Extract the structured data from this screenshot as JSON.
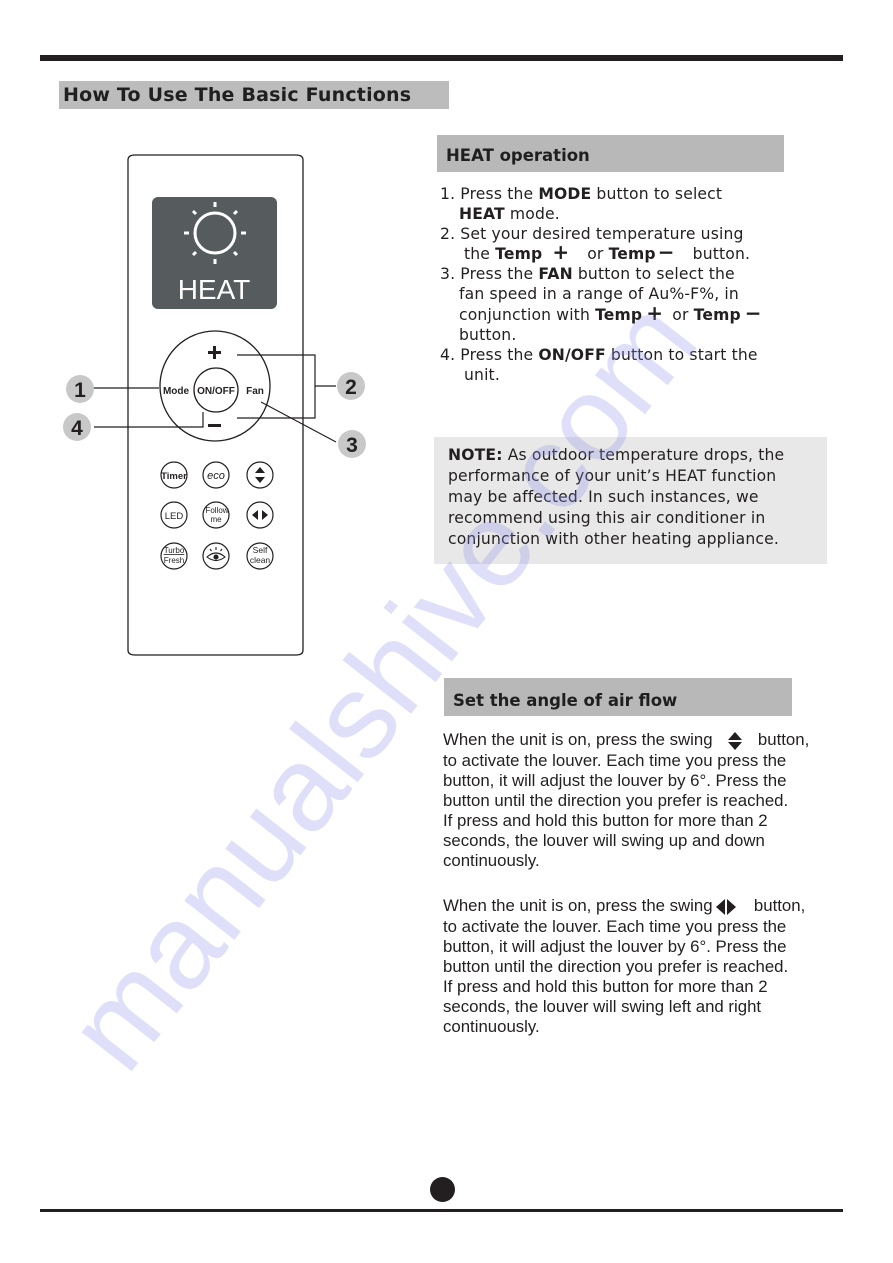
{
  "page": {
    "title": "How To Use The Basic Functions",
    "watermark": "manualshive.com"
  },
  "remote": {
    "display": {
      "mode_label": "HEAT",
      "icon": "sun-icon"
    },
    "ring": {
      "plus": "+",
      "minus": "−",
      "mode": "Mode",
      "onoff": "ON/OFF",
      "fan": "Fan"
    },
    "callouts": [
      "1",
      "2",
      "3",
      "4"
    ],
    "buttons": [
      {
        "lines": [
          "Timer"
        ],
        "icon": null
      },
      {
        "lines": [
          "eco"
        ],
        "icon": null
      },
      {
        "lines": [],
        "icon": "swing-vertical-icon"
      },
      {
        "lines": [
          "LED"
        ],
        "icon": null
      },
      {
        "lines": [
          "Follow",
          "me"
        ],
        "icon": null
      },
      {
        "lines": [],
        "icon": "swing-horizontal-icon"
      },
      {
        "lines": [
          "Turbo",
          "Fresh"
        ],
        "icon": null
      },
      {
        "lines": [],
        "icon": "eye-icon"
      },
      {
        "lines": [
          "Self",
          "clean"
        ],
        "icon": null
      }
    ]
  },
  "heat": {
    "heading": "HEAT operation",
    "step1": {
      "num": "1. ",
      "a": "Press the ",
      "b": "MODE",
      "c": " button to select",
      "d": "HEAT",
      "e": " mode."
    },
    "step2": {
      "num": "2. ",
      "a": "Set your desired temperature using",
      "b": "the ",
      "c": "Temp",
      "d": "+",
      "e": "or ",
      "f": "Temp",
      "g": "−",
      "h": "button."
    },
    "step3": {
      "num": "3. ",
      "a": "Press the ",
      "b": "FAN",
      "c": " button to select the",
      "d": "fan speed in a range of Au%-F%, in",
      "e": "conjunction with ",
      "f": "Temp",
      "g": "+",
      "h": " or ",
      "i": "Temp",
      "j": "−",
      "k": "button."
    },
    "step4": {
      "num": "4. ",
      "a": "Press the ",
      "b": "ON/OFF",
      "c": " button to start the",
      "d": "unit."
    },
    "note": {
      "label": "NOTE:",
      "lines": [
        " As outdoor temperature drops, the",
        "performance of your unit’s HEAT function",
        "may be affected. In such instances, we",
        "recommend using this air conditioner in",
        "conjunction with other heating appliance."
      ]
    }
  },
  "airflow": {
    "heading": "Set the angle of air flow",
    "para1": {
      "first_a": "When the unit is on, press the swing ",
      "first_b": " button,",
      "lines": [
        "to activate the louver. Each time you press the",
        "button, it will adjust the louver by 6°. Press the",
        "button until the direction you prefer is reached.",
        "If press and hold this button for more than 2",
        "seconds, the louver will swing up and down",
        "continuously."
      ]
    },
    "para2": {
      "first_a": "When the unit is on, press the swing ",
      "first_b": " button,",
      "lines": [
        "to activate the louver. Each time you press the",
        "button, it will adjust the louver by 6°. Press the",
        "button until the direction you prefer is reached.",
        "If press and hold this button for more than 2",
        "seconds, the louver will swing left and right",
        "continuously."
      ]
    }
  }
}
